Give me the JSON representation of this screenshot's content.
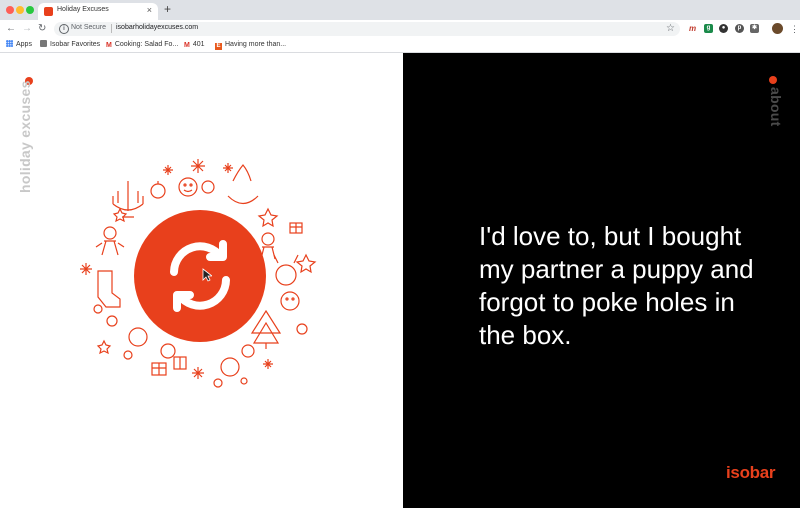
{
  "browser": {
    "tab_title": "Holiday Excuses",
    "tab_close": "×",
    "new_tab": "+",
    "security_label": "Not Secure",
    "url": "isobarholidayexcuses.com",
    "bookmarks": [
      {
        "label": "Apps",
        "icon": "apps-grid-icon"
      },
      {
        "label": "Isobar Favorites",
        "icon": "folder-icon"
      },
      {
        "label": "Cooking: Salad Fo...",
        "icon": "gmail-icon"
      },
      {
        "label": "401",
        "icon": "gmail-icon"
      },
      {
        "label": "Having more than...",
        "icon": "e-icon"
      }
    ]
  },
  "page": {
    "left_label": "holiday excuses",
    "right_label": "about",
    "excuse_text": "I'd love to, but I bought my partner a puppy and forgot to poke holes in the box.",
    "brand": "isobar"
  },
  "colors": {
    "accent": "#e8401c",
    "right_bg": "#000000",
    "left_bg": "#ffffff",
    "side_label_light": "#c8c8c8",
    "side_label_dark": "#4a4a4a"
  }
}
